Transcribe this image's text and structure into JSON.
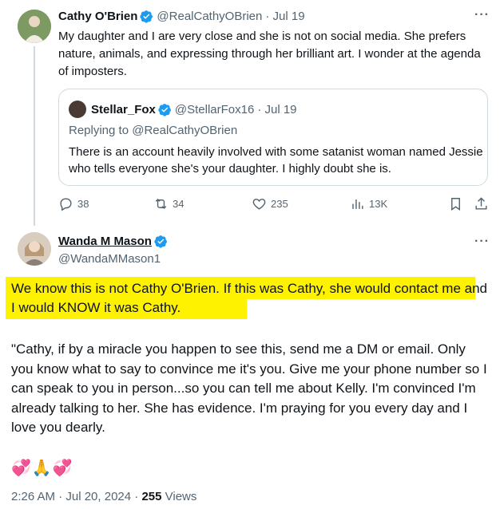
{
  "tweet1": {
    "name": "Cathy O'Brien",
    "handle": "@RealCathyOBrien",
    "date": "· Jul 19",
    "body": "My daughter and I are very close and she is not on social media. She prefers nature, animals, and expressing through her brilliant art. I wonder at the agenda of imposters."
  },
  "quote": {
    "name": "Stellar_Fox",
    "handle": "@StellarFox16",
    "date": "· Jul 19",
    "replying": "Replying to @RealCathyOBrien",
    "body": "There is an account heavily involved with some satanist woman named Jessie who tells everyone she's your daughter. I highly doubt she is."
  },
  "actions": {
    "replies": "38",
    "reposts": "34",
    "likes": "235",
    "views": "13K"
  },
  "tweet2": {
    "name": "Wanda M Mason",
    "handle": "@WandaMMason1",
    "body_highlighted": "We know this is not Cathy O'Brien. If this was Cathy, she would contact me and I would KNOW it was Cathy.",
    "body_quote": "\"Cathy, if by a miracle you happen to see this, send me a DM or email. Only you know what to say to convince me it's you. Give me your phone number so I can speak to you in person...so you can tell me about Kelly. I'm convinced I'm already talking to her. She has evidence. I'm praying for you every day and I love you dearly.",
    "emojis": [
      "💞",
      "🙏",
      "💞"
    ],
    "timestamp": "2:26 AM · Jul 20, 2024 · ",
    "views_count": "255",
    "views_label": " Views"
  },
  "colors": {
    "verified": "#1d9bf0",
    "highlight": "#fff200",
    "muted": "#536471"
  }
}
